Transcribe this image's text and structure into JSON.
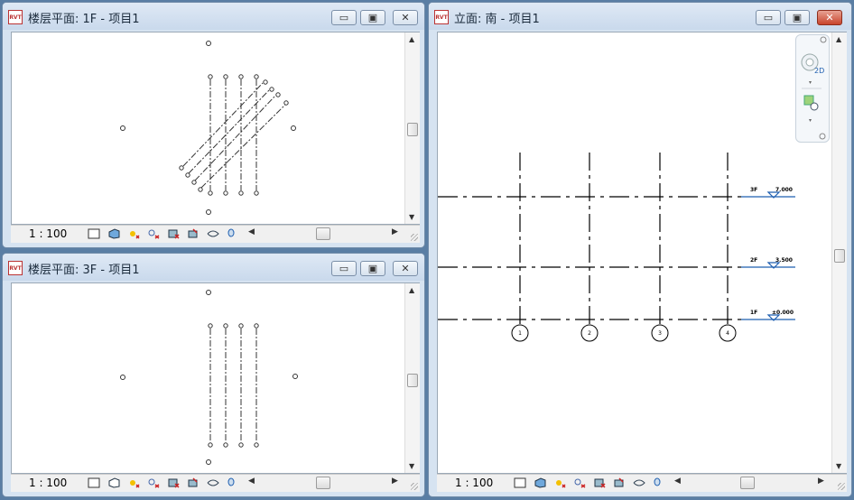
{
  "windows": {
    "plan1": {
      "title": "楼层平面: 1F - 项目1",
      "scale": "1 : 100"
    },
    "plan3": {
      "title": "楼层平面: 3F - 项目1",
      "scale": "1 : 100"
    },
    "elev": {
      "title": "立面: 南 - 项目1",
      "scale": "1 : 100"
    }
  },
  "app_icon_text": "RVT",
  "window_buttons": {
    "minimize": "▭",
    "restore": "▣",
    "close": "✕"
  },
  "elevation_levels": [
    {
      "name": "3F",
      "elevation": "7.000"
    },
    {
      "name": "2F",
      "elevation": "3.500"
    },
    {
      "name": "1F",
      "elevation": "±0.000"
    }
  ],
  "grid_labels": [
    "1",
    "2",
    "3",
    "4"
  ],
  "view_controls": [
    "visual-style-icon",
    "3d-box-icon",
    "sun-path-icon",
    "shadows-icon",
    "crop-icon",
    "temp-hide-icon",
    "reveal-hidden-icon",
    "highlight-icon"
  ],
  "colors": {
    "accent_blue": "#1f5fb0",
    "titlebar": "#d6e3f1",
    "close_red": "#c8442c"
  }
}
